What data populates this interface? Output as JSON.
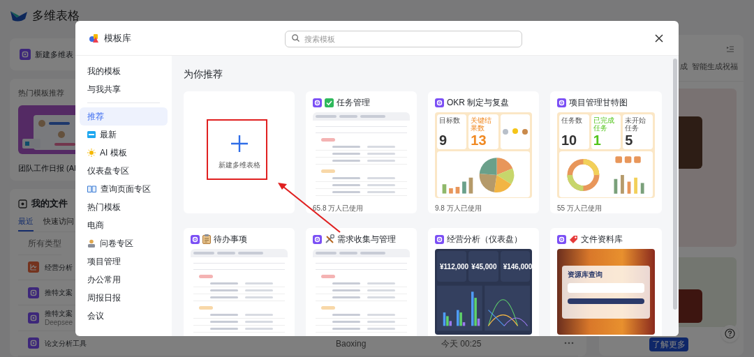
{
  "background": {
    "app_title": "多维表格",
    "new_table_label": "新建多维表",
    "hot_templates": {
      "title": "热门模板推荐",
      "caption": "团队工作日报 (AI"
    },
    "my_files": {
      "title": "我的文件",
      "tabs": [
        {
          "label": "最近",
          "selected": true
        },
        {
          "label": "快速访问",
          "selected": false
        }
      ],
      "filter": "所有类型",
      "rows": [
        {
          "name": "经营分析",
          "kind": "dashboard"
        },
        {
          "name": "推特文案",
          "kind": "table"
        },
        {
          "name": "推特文案",
          "kind": "table",
          "subtitle": "Deepsee"
        },
        {
          "name": "论文分析工具",
          "kind": "table",
          "owner": "Baoxing",
          "time": "今天 00:25"
        }
      ]
    },
    "side_panel": {
      "tabs": [
        "成",
        "智能生成祝福"
      ],
      "learn_more": "了解更多"
    }
  },
  "modal": {
    "title": "模板库",
    "search": {
      "placeholder": "搜索模板"
    },
    "sidebar_groups": [
      [
        {
          "label": "我的模板",
          "kind": "plain",
          "selected": false
        },
        {
          "label": "与我共享",
          "kind": "plain",
          "selected": false
        }
      ],
      [
        {
          "label": "推荐",
          "kind": "plain",
          "selected": true
        },
        {
          "label": "最新",
          "kind": "new",
          "selected": false
        },
        {
          "label": "AI 模板",
          "kind": "sun",
          "selected": false
        },
        {
          "label": "仪表盘专区",
          "kind": "plain",
          "selected": false
        },
        {
          "label": "查询页面专区",
          "kind": "book",
          "selected": false
        },
        {
          "label": "热门模板",
          "kind": "plain",
          "selected": false
        },
        {
          "label": "电商",
          "kind": "plain",
          "selected": false
        },
        {
          "label": "问卷专区",
          "kind": "person",
          "selected": false
        },
        {
          "label": "项目管理",
          "kind": "plain",
          "selected": false
        },
        {
          "label": "办公常用",
          "kind": "plain",
          "selected": false
        },
        {
          "label": "周报日报",
          "kind": "plain",
          "selected": false
        },
        {
          "label": "会议",
          "kind": "plain",
          "selected": false
        }
      ]
    ],
    "section_title": "为你推荐",
    "cards": [
      {
        "kind": "new",
        "label": "新建多维表格"
      },
      {
        "kind": "template",
        "title": "任务管理",
        "badge": {
          "kind": "check"
        },
        "preview": {
          "kind": "table"
        },
        "usage": "65.8 万人已使用"
      },
      {
        "kind": "template",
        "title": "OKR 制定与复盘",
        "preview": {
          "kind": "stats",
          "chart": {
            "kind": "pie"
          },
          "stats": [
            {
              "label": "目标数",
              "value": "9",
              "color": "#333333"
            },
            {
              "label": "关键结果数",
              "value": "13",
              "color": "#f08a24"
            }
          ]
        },
        "usage": "9.8 万人已使用"
      },
      {
        "kind": "template",
        "title": "项目管理甘特图",
        "preview": {
          "kind": "stats",
          "chart": {
            "kind": "donut"
          },
          "stats": [
            {
              "label": "任务数",
              "value": "10",
              "color": "#333333"
            },
            {
              "label": "已完成任务",
              "value": "1",
              "color": "#52c41a"
            },
            {
              "label": "未开始任务",
              "value": "5",
              "color": "#333333"
            }
          ]
        },
        "usage": "55 万人已使用"
      },
      {
        "kind": "template",
        "title": "待办事项",
        "badge": {
          "kind": "clipboard"
        },
        "preview": {
          "kind": "table"
        }
      },
      {
        "kind": "template",
        "title": "需求收集与管理",
        "badge": {
          "kind": "tools"
        },
        "preview": {
          "kind": "table"
        }
      },
      {
        "kind": "template",
        "title": "经营分析（仪表盘）",
        "preview": {
          "kind": "dark",
          "values": [
            "¥112,000",
            "¥45,000",
            "¥146,000"
          ]
        }
      },
      {
        "kind": "template",
        "title": "文件资料库",
        "badge": {
          "kind": "tag"
        },
        "preview": {
          "kind": "photo",
          "form_title": "资源库查询"
        }
      }
    ]
  }
}
